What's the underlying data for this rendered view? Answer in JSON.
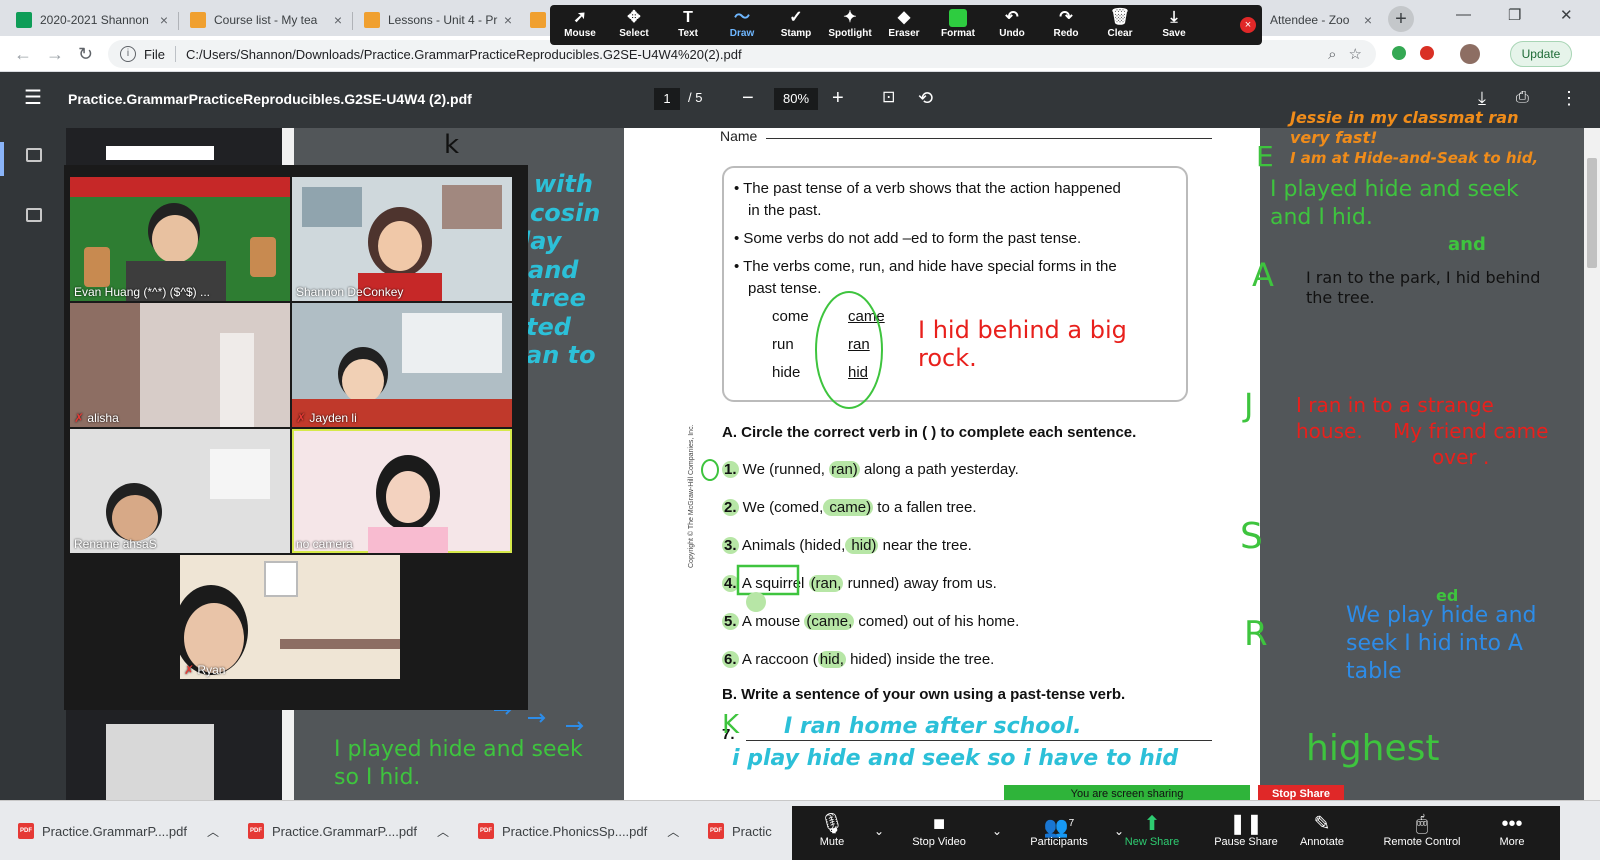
{
  "browser": {
    "tabs": [
      {
        "title": "2020-2021 Shannon",
        "color": "#0f9d58"
      },
      {
        "title": "Course list - My tea",
        "color": "#f0a030"
      },
      {
        "title": "Lessons - Unit 4 - Pr",
        "color": "#f0a030"
      },
      {
        "title": "",
        "color": "#f0a030"
      },
      {
        "title": "Attendee - Zoo",
        "color": "#2d8cff"
      }
    ],
    "file_label": "File",
    "url": "C:/Users/Shannon/Downloads/Practice.GrammarPracticeReproducibles.G2SE-U4W4%20(2).pdf",
    "update_label": "Update"
  },
  "annotation_toolbar": {
    "tools": [
      {
        "label": "Mouse",
        "icon": "mouse-pointer-icon",
        "glyph": "➚"
      },
      {
        "label": "Select",
        "icon": "select-move-icon",
        "glyph": "✥"
      },
      {
        "label": "Text",
        "icon": "text-T-icon",
        "glyph": "T"
      },
      {
        "label": "Draw",
        "icon": "draw-squiggle-icon",
        "glyph": "〜"
      },
      {
        "label": "Stamp",
        "icon": "stamp-check-icon",
        "glyph": "✓"
      },
      {
        "label": "Spotlight",
        "icon": "spotlight-wand-icon",
        "glyph": "✦"
      },
      {
        "label": "Eraser",
        "icon": "eraser-icon",
        "glyph": "◆"
      },
      {
        "label": "Format",
        "icon": "format-color-icon",
        "glyph": ""
      },
      {
        "label": "Undo",
        "icon": "undo-icon",
        "glyph": "↶"
      },
      {
        "label": "Redo",
        "icon": "redo-icon",
        "glyph": "↷"
      },
      {
        "label": "Clear",
        "icon": "trash-icon",
        "glyph": "🗑"
      },
      {
        "label": "Save",
        "icon": "save-download-icon",
        "glyph": "⤓"
      }
    ],
    "active": "Draw",
    "format_color": "#2ecc40"
  },
  "pdf": {
    "filename": "Practice.GrammarPracticeReproducibles.G2SE-U4W4 (2).pdf",
    "page": "1",
    "total": "/ 5",
    "zoom": "80%"
  },
  "worksheet": {
    "name_label": "Name",
    "rules": [
      "• The past tense of a verb shows that the action happened",
      "  in the past.",
      "• Some verbs do not add –ed to form the past tense.",
      "• The verbs come, run, and hide have special forms in the",
      "  past tense."
    ],
    "verbs": [
      {
        "present": "come",
        "past": "came"
      },
      {
        "present": "run",
        "past": "ran"
      },
      {
        "present": "hide",
        "past": "hid"
      }
    ],
    "section_a": "A. Circle the correct verb in ( ) to complete each sentence.",
    "items": [
      {
        "num": "1.",
        "pre": " We (runned, ",
        "hl": "ran)",
        "post": " along a path yesterday."
      },
      {
        "num": "2.",
        "pre": " We (comed,",
        "hl": " came)",
        "post": " to a fallen tree."
      },
      {
        "num": "3.",
        "pre": " Animals (hided,",
        "hl": " hid)",
        "post": " near the tree."
      },
      {
        "num": "4.",
        "pre": " A squirrel ",
        "hl": "(ran,",
        "post": " runned) away from us."
      },
      {
        "num": "5.",
        "pre": " A mouse ",
        "hl": "(came,",
        "post": " comed) out of his home."
      },
      {
        "num": "6.",
        "pre": " A raccoon (",
        "hl": "hid,",
        "post": " hided) inside the tree."
      }
    ],
    "section_b": "B. Write a sentence of your own using a past-tense verb.",
    "item7": "7.",
    "copyright": "Copyright © The McGraw-Hill Companies, Inc."
  },
  "annotations": {
    "left_fragments": [
      "with",
      "cosin",
      "lay",
      "and",
      "tree",
      "ted",
      "an to"
    ],
    "left_k": "k",
    "left_sentence": [
      "I played hide and seek",
      "so I hid."
    ],
    "box_sentence": [
      "I hid behind a big",
      "rock."
    ],
    "line7_a": "I ran home after school.",
    "line7_b": "i play hide and seek so i have to hid",
    "mark_k": "K",
    "orange": [
      "Jessie in my classmat ran",
      "very fast!",
      "I am at Hide-and-Seak to hid,"
    ],
    "E": "E",
    "green_right": [
      "I played hide and seek",
      "and I hid."
    ],
    "A": "A",
    "and_word": "and",
    "black_right": [
      "I ran to the park, I hid behind",
      "the tree."
    ],
    "J": "J",
    "red_right": [
      "I ran in to a strange",
      "house.",
      "My friend came",
      "over ."
    ],
    "S": "S",
    "R": "R",
    "blue_right": [
      "We play  hide and",
      "seek I hid into A",
      "table"
    ],
    "ed": "ed",
    "highest": "highest",
    "colors": {
      "green": "#3ec43e",
      "red": "#e8201c",
      "blue": "#2d8ce8",
      "orange": "#f08c1a",
      "teal": "#2cc0d8"
    }
  },
  "gallery": {
    "participants": [
      {
        "name": "Evan Huang (*^*) ($^$) ...",
        "muted": false
      },
      {
        "name": "Shannon DeConkey",
        "muted": false
      },
      {
        "name": "alisha",
        "muted": true
      },
      {
        "name": "Jayden li",
        "muted": true
      },
      {
        "name": "Rename ahsaS",
        "muted": false
      },
      {
        "name": "no camera",
        "muted": false
      },
      {
        "name": "Ryan",
        "muted": true
      }
    ]
  },
  "taskbar": {
    "items": [
      "Practice.GrammarP....pdf",
      "Practice.GrammarP....pdf",
      "Practice.PhonicsSp....pdf",
      "Practic"
    ]
  },
  "zoom_controls": {
    "sharing": "You are screen sharing",
    "stop_share": "Stop Share",
    "buttons": [
      {
        "label": "Mute",
        "glyph": "🎙",
        "icon": "microphone-icon"
      },
      {
        "label": "Stop Video",
        "glyph": "■",
        "icon": "video-camera-icon"
      },
      {
        "label": "Participants",
        "glyph": "👥",
        "icon": "participants-icon"
      },
      {
        "label": "New Share",
        "glyph": "⬆",
        "icon": "new-share-icon"
      },
      {
        "label": "Pause Share",
        "glyph": "❚❚",
        "icon": "pause-icon"
      },
      {
        "label": "Annotate",
        "glyph": "✎",
        "icon": "annotate-pencil-icon"
      },
      {
        "label": "Remote Control",
        "glyph": "🖱",
        "icon": "remote-control-icon"
      },
      {
        "label": "More",
        "glyph": "•••",
        "icon": "more-dots-icon"
      }
    ],
    "participant_count": "7"
  }
}
